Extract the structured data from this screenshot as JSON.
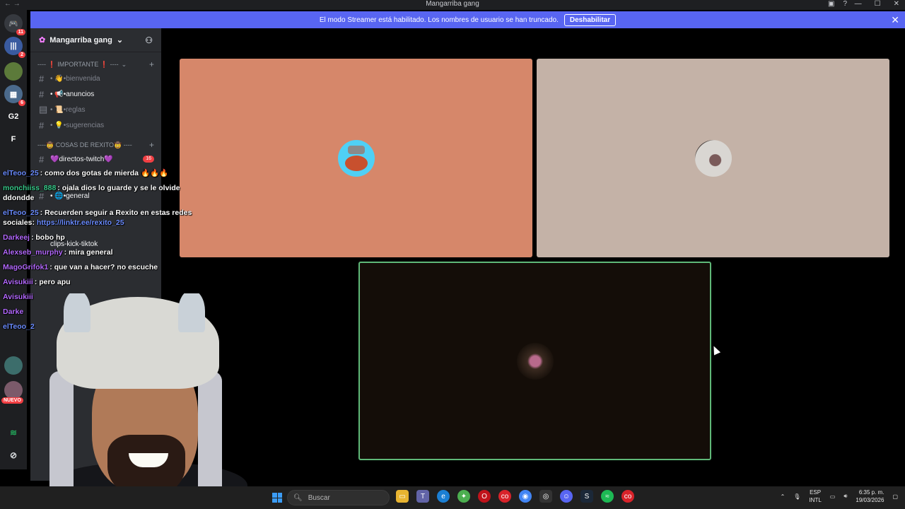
{
  "window": {
    "title": "Mangarriba gang",
    "nav": "← →"
  },
  "banner": {
    "text": "El modo Streamer está habilitado. Los nombres de usuario se han truncado.",
    "button": "Deshabilitar",
    "close": "✕"
  },
  "servers": [
    {
      "label": "11"
    },
    {
      "label": "2"
    },
    {
      "label": ""
    },
    {
      "label": "6"
    },
    {
      "label": "G2"
    },
    {
      "label": "F"
    }
  ],
  "sidebar": {
    "server_name": "Mangarriba gang",
    "categories": [
      {
        "label": "---- ❗ IMPORTANTE ❗ ----"
      },
      {
        "label": "----🤠 COSAS DE REXITO🤠 ----"
      }
    ],
    "channels_a": [
      {
        "label": "• 👋•bienvenida"
      },
      {
        "label": "• 📢•anuncios"
      },
      {
        "label": "• 📜•reglas"
      },
      {
        "label": "• 💡•sugerencias"
      }
    ],
    "channel_twitch": {
      "label": "💜directos-twitch💜",
      "count": "16"
    },
    "channels_b": [
      {
        "label": "• 🌐•general"
      },
      {
        "label": "clips-kick-tiktok"
      }
    ],
    "nuevo_badge": "NUEVO"
  },
  "chat": [
    {
      "user": "elTeoo_25",
      "text": ": como dos gotas de mierda 🔥🔥🔥",
      "color": "#6b8cff"
    },
    {
      "user": "monchiiss_888",
      "text": ": ojala dios lo guarde y se le olvide ddondde",
      "color": "#38c98a"
    },
    {
      "user": "elTeoo_25",
      "text": ": Recuerden seguir a Rexito en estas redes sociales: ",
      "link": "https://linktr.ee/rexito_25",
      "color": "#6b8cff"
    },
    {
      "user": "Darkeej",
      "text": ": bobo hp",
      "color": "#b469ff"
    },
    {
      "user": "Alexseb_murphy",
      "text": ": mira general",
      "color": "#b469ff"
    },
    {
      "user": "MagoGrifok1",
      "text": ": que van a hacer? no escuche",
      "color": "#b469ff"
    },
    {
      "user": "Avisukiii",
      "text": ": pero apu",
      "color": "#b469ff"
    },
    {
      "user": "Avisukiii",
      "text": "",
      "color": "#b469ff"
    },
    {
      "user": "Darke",
      "text": "",
      "color": "#b469ff"
    },
    {
      "user": "elTeoo_2",
      "text": "",
      "color": "#6b8cff"
    }
  ],
  "tiles": [
    {
      "color": "#d6876a"
    },
    {
      "color": "#c4b2a7"
    },
    {
      "color": "#140d08"
    }
  ],
  "taskbar": {
    "search_placeholder": "Buscar",
    "lang_1": "ESP",
    "lang_2": "INTL",
    "time": "6:35 p. m.",
    "date": "19/03/2026"
  },
  "colors": {
    "banner": "#5865f2",
    "sidebar": "#2b2d31",
    "server_rail": "#1e1f22"
  }
}
